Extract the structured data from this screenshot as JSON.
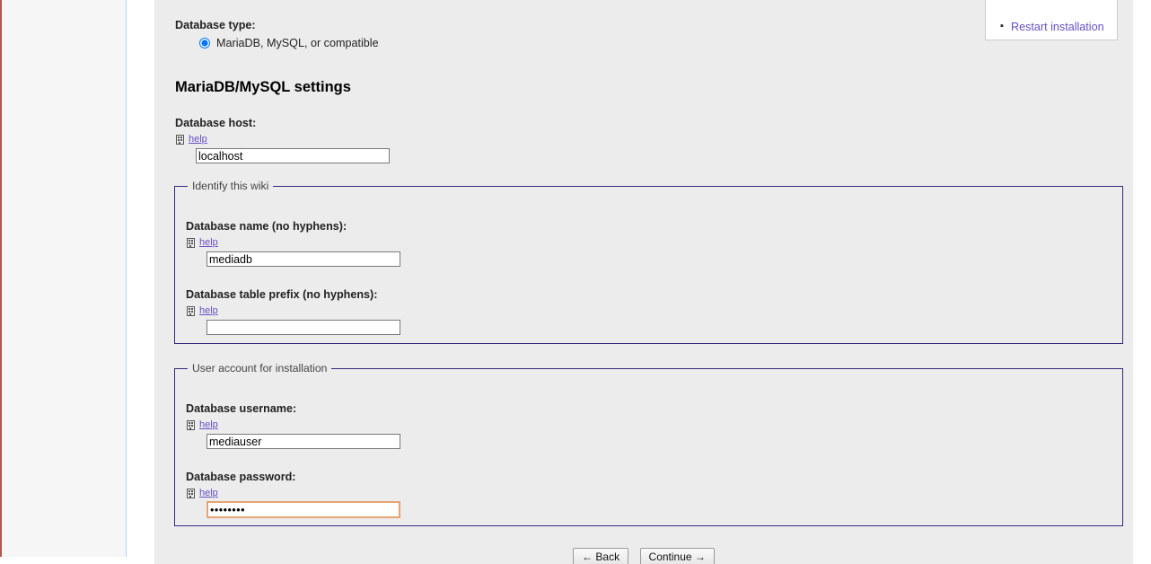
{
  "restart_box": {
    "link_label": "Restart installation",
    "link_color": "#6a4fc4"
  },
  "database_type": {
    "label": "Database type:",
    "options": [
      {
        "label": "MariaDB, MySQL, or compatible",
        "selected": true
      }
    ]
  },
  "settings_heading": "MariaDB/MySQL settings",
  "database_host": {
    "label": "Database host:",
    "help_label": "help",
    "value": "localhost",
    "placeholder": ""
  },
  "identify_fieldset": {
    "legend": "Identify this wiki",
    "database_name": {
      "label": "Database name (no hyphens):",
      "help_label": "help",
      "value": "mediadb",
      "placeholder": ""
    },
    "table_prefix": {
      "label": "Database table prefix (no hyphens):",
      "help_label": "help",
      "value": "",
      "placeholder": ""
    }
  },
  "user_account_fieldset": {
    "legend": "User account for installation",
    "database_username": {
      "label": "Database username:",
      "help_label": "help",
      "value": "mediauser",
      "placeholder": ""
    },
    "database_password": {
      "label": "Database password:",
      "help_label": "help",
      "value": "••••••••",
      "placeholder": "",
      "focused": true,
      "focus_border_color": "#e8a273"
    }
  },
  "buttons": {
    "back_label": "← Back",
    "continue_label": "Continue →"
  },
  "colors": {
    "content_background": "#ececec",
    "sidebar_background": "#f6f6f6",
    "fieldset_border": "#36287e",
    "link": "#6a4fc4"
  }
}
